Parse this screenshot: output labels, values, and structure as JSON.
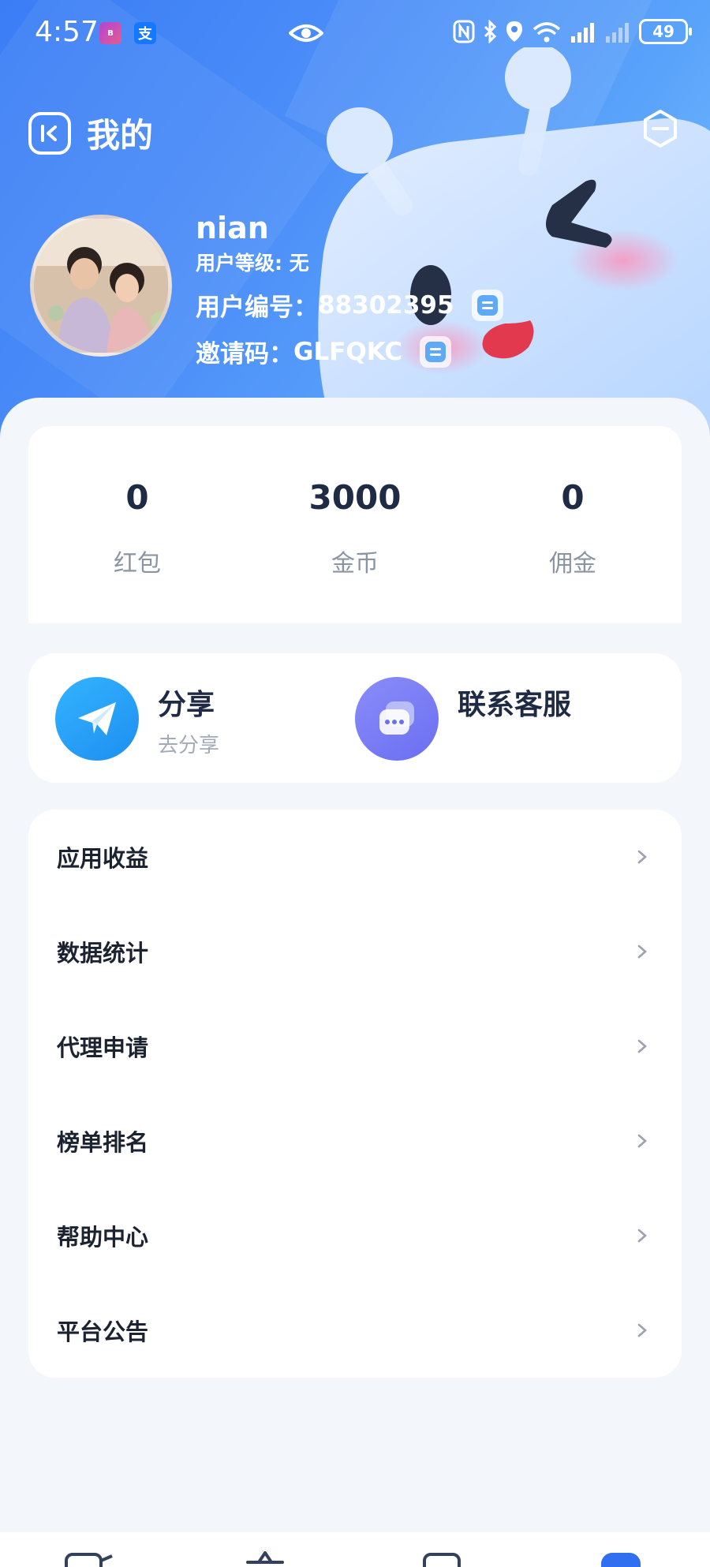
{
  "status_bar": {
    "time": "4:57",
    "battery": "49",
    "app_icons": [
      "bank-app-icon",
      "alipay-icon"
    ],
    "system_icons": [
      "eye-icon",
      "nfc-icon",
      "bluetooth-icon",
      "location-icon",
      "wifi-icon",
      "signal-icon",
      "signal-icon"
    ]
  },
  "header": {
    "title": "我的"
  },
  "profile": {
    "username": "nian",
    "level_label": "用户等级:",
    "level_value": "无",
    "user_id_label": "用户编号：",
    "user_id": "88302395",
    "invite_label": "邀请码：",
    "invite_code": "GLFQKC"
  },
  "stats": [
    {
      "value": "0",
      "label": "红包"
    },
    {
      "value": "3000",
      "label": "金币"
    },
    {
      "value": "0",
      "label": "佣金"
    }
  ],
  "actions": {
    "share_title": "分享",
    "share_sub": "去分享",
    "service_title": "联系客服"
  },
  "menu": [
    {
      "label": "应用收益"
    },
    {
      "label": "数据统计"
    },
    {
      "label": "代理申请"
    },
    {
      "label": "榜单排名"
    },
    {
      "label": "帮助中心"
    },
    {
      "label": "平台公告"
    }
  ],
  "colors": {
    "accent": "#3a7df5",
    "share": "#1e8ef0",
    "service": "#6a6ef2"
  }
}
